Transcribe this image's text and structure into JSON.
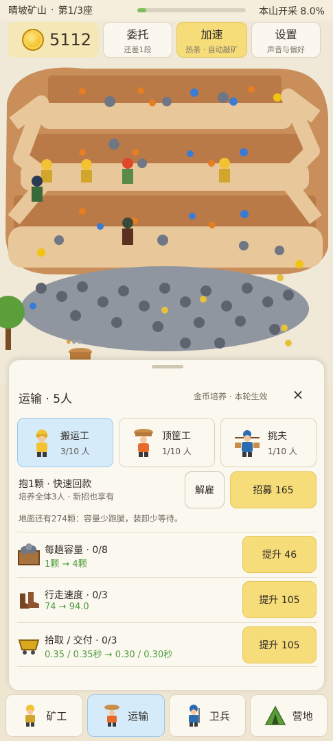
{
  "top_bar": {
    "title": "晴坡矿山",
    "progress_label": "第1/3座",
    "mine_progress": 0.08,
    "mine_progress_text": "本山开采 8.0%"
  },
  "hud": {
    "coins": "5112",
    "buttons": [
      {
        "label": "委托",
        "sub": "还差1段"
      },
      {
        "label": "加速",
        "sub": "热茶 · 自动敲矿"
      },
      {
        "label": "设置",
        "sub": "声音与偏好"
      }
    ]
  },
  "panel": {
    "title": "运输 · 5人",
    "note": "金币培养 · 本轮生效",
    "close": "×",
    "workers": [
      {
        "name": "搬运工",
        "count": "3/10 人",
        "icon": "porter-icon"
      },
      {
        "name": "顶筐工",
        "count": "1/10 人",
        "icon": "basket-carrier-icon"
      },
      {
        "name": "挑夫",
        "count": "1/10 人",
        "icon": "pole-carrier-icon"
      }
    ],
    "perk_title": "抱1颗 · 快速回款",
    "perk_desc": "培养全体3人 · 新招也享有",
    "fire_label": "解雇",
    "recruit_label": "招募 165",
    "ground_note": "地面还有274颗：容量少跑腿，装卸少等待。",
    "upgrades": [
      {
        "name": "每趟容量 · 0/8",
        "value": "1颗 → 4颗",
        "button": "提升 46",
        "icon": "ore-crate-icon"
      },
      {
        "name": "行走速度 · 0/3",
        "value": "74 → 94.0",
        "button": "提升 105",
        "icon": "boots-icon"
      },
      {
        "name": "拾取 / 交付 · 0/3",
        "value": "0.35 / 0.35秒 → 0.30 / 0.30秒",
        "button": "提升 105",
        "icon": "mine-cart-icon"
      }
    ]
  },
  "nav": [
    {
      "label": "矿工",
      "icon": "miner-icon"
    },
    {
      "label": "运输",
      "icon": "transport-icon"
    },
    {
      "label": "卫兵",
      "icon": "guard-icon"
    },
    {
      "label": "营地",
      "icon": "camp-tent-icon"
    }
  ],
  "colors": {
    "accent_yellow": "#f6dd7a",
    "active_blue": "#d6ebfa",
    "upgrade_green": "#4e9a3c",
    "progress_green": "#7bbf5a"
  }
}
